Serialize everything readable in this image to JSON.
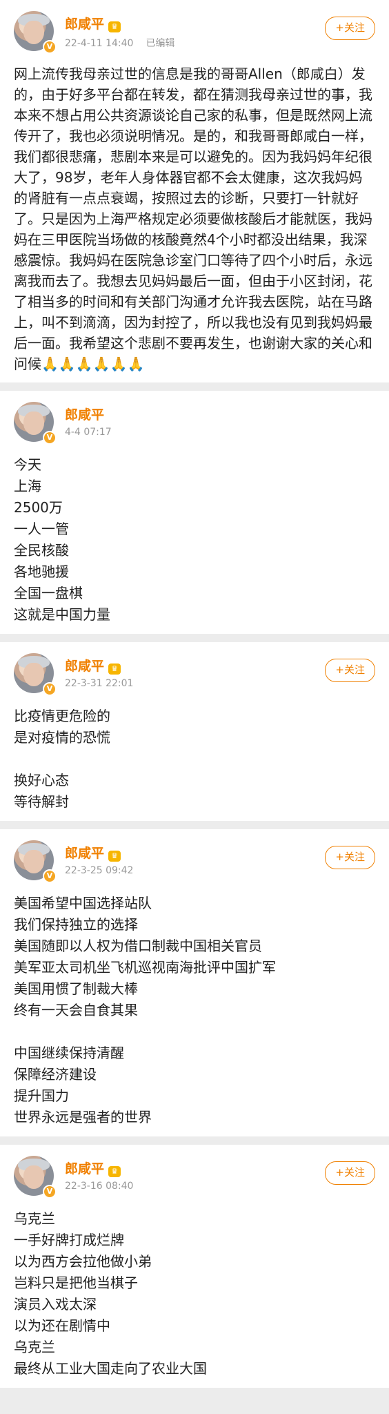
{
  "author": {
    "name": "郎咸平",
    "verified_badge": "V",
    "crown_icon": "crown-icon"
  },
  "follow_label": "+关注",
  "posts": [
    {
      "time": "22-4-11 14:40",
      "edited": "已编辑",
      "follow": true,
      "paragraph": "网上流传我母亲过世的信息是我的哥哥Allen（郎咸白）发的，由于好多平台都在转发，都在猜测我母亲过世的事，我本来不想占用公共资源谈论自己家的私事，但是既然网上流传开了，我也必须说明情况。是的，和我哥哥郎咸白一样，我们都很悲痛，悲剧本来是可以避免的。因为我妈妈年纪很大了，98岁，老年人身体器官都不会太健康，这次我妈妈的肾脏有一点点衰竭，按照过去的诊断，只要打一针就好了。只是因为上海严格规定必须要做核酸后才能就医，我妈妈在三甲医院当场做的核酸竟然4个小时都没出结果，我深感震惊。我妈妈在医院急诊室门口等待了四个小时后，永远离我而去了。我想去见妈妈最后一面，但由于小区封闭，花了相当多的时间和有关部门沟通才允许我去医院，站在马路上，叫不到滴滴，因为封控了，所以我也没有见到我妈妈最后一面。我希望这个悲剧不要再发生，也谢谢大家的关心和问候🙏🙏🙏🙏🙏🙏"
    },
    {
      "time": "4-4 07:17",
      "follow": false,
      "lines": [
        "今天",
        "上海",
        "2500万",
        "一人一管",
        "全民核酸",
        "各地驰援",
        "全国一盘棋",
        "这就是中国力量"
      ]
    },
    {
      "time": "22-3-31 22:01",
      "follow": true,
      "lines": [
        "比疫情更危险的",
        "是对疫情的恐慌",
        "",
        "换好心态",
        "等待解封"
      ]
    },
    {
      "time": "22-3-25 09:42",
      "follow": true,
      "lines": [
        "美国希望中国选择站队",
        "我们保持独立的选择",
        "美国随即以人权为借口制裁中国相关官员",
        "美军亚太司机坐飞机巡视南海批评中国扩军",
        "美国用惯了制裁大棒",
        "终有一天会自食其果",
        "",
        "中国继续保持清醒",
        "保障经济建设",
        "提升国力",
        "世界永远是强者的世界"
      ]
    },
    {
      "time": "22-3-16 08:40",
      "follow": true,
      "lines": [
        "乌克兰",
        "一手好牌打成烂牌",
        "以为西方会拉他做小弟",
        "岂料只是把他当棋子",
        "演员入戏太深",
        "以为还在剧情中",
        "乌克兰",
        "最终从工业大国走向了农业大国"
      ]
    }
  ]
}
